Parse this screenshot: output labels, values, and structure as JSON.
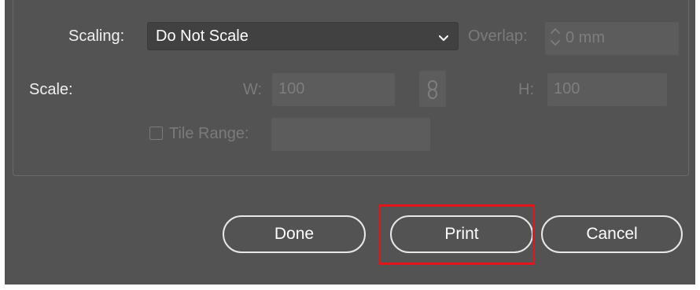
{
  "scaling": {
    "label": "Scaling:",
    "selected": "Do Not Scale",
    "overlap_label": "Overlap:",
    "overlap_value": "0 mm"
  },
  "scale": {
    "label": "Scale:",
    "w_label": "W:",
    "w_value": "100",
    "h_label": "H:",
    "h_value": "100",
    "link_icon": "chain-link-icon"
  },
  "tile": {
    "label": "Tile Range:",
    "value": ""
  },
  "buttons": {
    "done": "Done",
    "print": "Print",
    "cancel": "Cancel"
  },
  "colors": {
    "panel": "#535353",
    "highlight": "#e4161c"
  }
}
